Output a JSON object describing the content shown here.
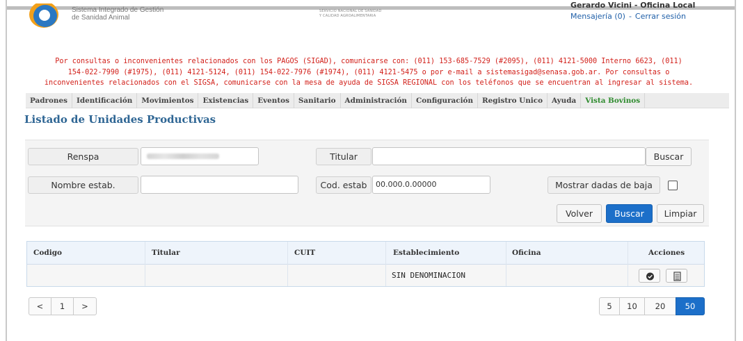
{
  "header": {
    "logo_line1": "Sistema Integrado de Gestión",
    "logo_line2": "de Sanidad Animal",
    "senasa_line1": "SERVICIO NACIONAL DE SANIDAD",
    "senasa_line2": "Y CALIDAD AGROALIMENTARIA",
    "user": "Gerardo Vicini - Oficina Local",
    "messaging": "Mensajería (0)",
    "separator": "-",
    "logout": "Cerrar sesión"
  },
  "notice": {
    "line1": "Por consultas o inconvenientes relacionados con los PAGOS (SIGAD), comunicarse con: (011) 153-685-7529 (#2095), (011) 4121-5000 Interno 6623, (011)",
    "line2": "154-022-7990 (#1975), (011) 4121-5124, (011) 154-022-7976 (#1974), (011) 4121-5475 o por e-mail a sistemasigad@senasa.gob.ar. Por consultas o",
    "line3": "inconvenientes relacionados con el SIGSA, comunicarse con la mesa de ayuda de SIGSA REGIONAL con los teléfonos que se encuentran al ingresar al sistema."
  },
  "menu": {
    "items": [
      {
        "label": "Padrones"
      },
      {
        "label": "Identificación"
      },
      {
        "label": "Movimientos"
      },
      {
        "label": "Existencias"
      },
      {
        "label": "Eventos"
      },
      {
        "label": "Sanitario"
      },
      {
        "label": "Administración"
      },
      {
        "label": "Configuración"
      },
      {
        "label": "Registro Unico"
      },
      {
        "label": "Ayuda"
      },
      {
        "label": "Vista Bovinos"
      }
    ]
  },
  "page_title": "Listado de Unidades Productivas",
  "filters": {
    "renspa_label": "Renspa",
    "renspa_value": "",
    "titular_label": "Titular",
    "titular_value": "",
    "titular_search": "Buscar",
    "nombre_label": "Nombre estab.",
    "nombre_value": "",
    "cod_label": "Cod. estab",
    "cod_value": "00.000.0.00000",
    "bajas_label": "Mostrar dadas de baja",
    "bajas_checked": false,
    "back_button": "Volver",
    "search_button": "Buscar",
    "clear_button": "Limpiar"
  },
  "table": {
    "columns": [
      "Codigo",
      "Titular",
      "CUIT",
      "Establecimiento",
      "Oficina",
      "Acciones"
    ],
    "rows": [
      {
        "codigo": "",
        "titular": "",
        "cuit": "",
        "establecimiento": "SIN DENOMINACION",
        "oficina": ""
      }
    ]
  },
  "pagination": {
    "prev": "<",
    "page": "1",
    "next": ">",
    "sizes": [
      "5",
      "10",
      "20",
      "50"
    ],
    "active_size": "50"
  },
  "colors": {
    "accent": "#1c6fc9",
    "title": "#2f6694",
    "notice": "#d2201a",
    "menu_highlight": "#2e8b2e"
  }
}
